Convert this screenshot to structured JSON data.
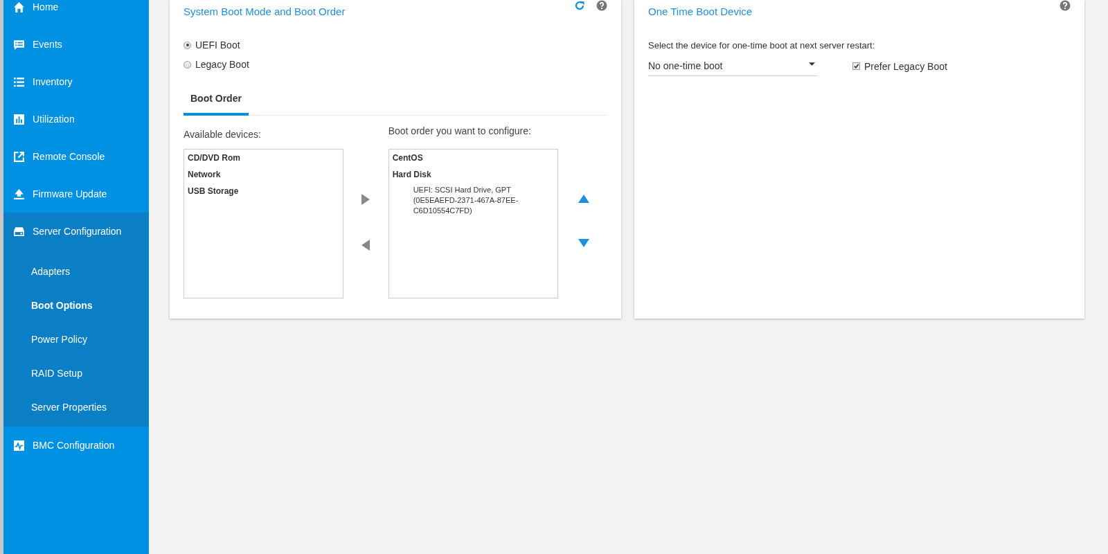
{
  "sidebar": {
    "items": [
      {
        "label": "Home",
        "kind": "home",
        "expanded": false,
        "selected": false
      },
      {
        "label": "Events",
        "kind": "events",
        "expanded": false,
        "selected": false
      },
      {
        "label": "Inventory",
        "kind": "list",
        "expanded": false,
        "selected": false
      },
      {
        "label": "Utilization",
        "kind": "chart",
        "expanded": false,
        "selected": false
      },
      {
        "label": "Remote Console",
        "kind": "external",
        "expanded": false,
        "selected": false
      },
      {
        "label": "Firmware Update",
        "kind": "upload",
        "expanded": false,
        "selected": false
      },
      {
        "label": "Server Configuration",
        "kind": "server",
        "expanded": true,
        "selected": false,
        "children": [
          {
            "label": "Adapters",
            "selected": false
          },
          {
            "label": "Boot Options",
            "selected": true
          },
          {
            "label": "Power Policy",
            "selected": false
          },
          {
            "label": "RAID Setup",
            "selected": false
          },
          {
            "label": "Server Properties",
            "selected": false
          }
        ]
      },
      {
        "label": "BMC Configuration",
        "kind": "pulse",
        "expanded": false,
        "selected": false
      }
    ]
  },
  "boot_order_panel": {
    "title": "System Boot Mode and Boot Order",
    "boot_modes": [
      {
        "label": "UEFI Boot",
        "selected": true
      },
      {
        "label": "Legacy Boot",
        "selected": false
      }
    ],
    "tabs": [
      {
        "label": "Boot Order",
        "selected": true
      }
    ],
    "available": {
      "label": "Available devices:",
      "items": [
        {
          "label": "CD/DVD Rom"
        },
        {
          "label": "Network"
        },
        {
          "label": "USB Storage"
        }
      ]
    },
    "configured": {
      "label": "Boot order you want to configure:",
      "items": [
        {
          "label": "CentOS"
        },
        {
          "label": "Hard Disk",
          "children": [
            {
              "label": "UEFI: SCSI Hard Drive, GPT (0E5EAEFD-2371-467A-87EE-C6D10554C7FD)"
            }
          ]
        }
      ]
    }
  },
  "one_time_boot_panel": {
    "title": "One Time Boot Device",
    "prompt": "Select the device for one-time boot at next server restart:",
    "device": {
      "value": "No one-time boot"
    },
    "prefer_legacy": {
      "label": "Prefer Legacy Boot",
      "checked": true
    }
  }
}
